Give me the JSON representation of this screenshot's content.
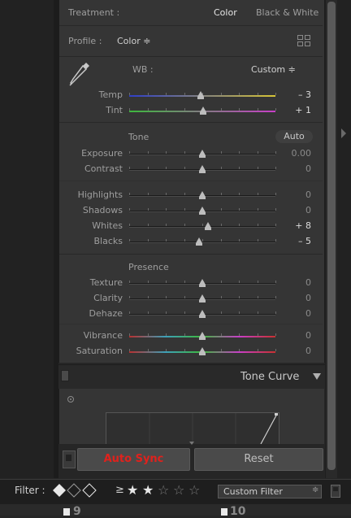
{
  "basic": {
    "treatment_label": "Treatment :",
    "treatment_color": "Color",
    "treatment_bw": "Black & White",
    "profile_label": "Profile :",
    "profile_value": "Color ≑",
    "wb_label": "WB :",
    "wb_value": "Custom ≑"
  },
  "wb_sliders": [
    {
      "label": "Temp",
      "value": "– 3",
      "level": 0.49
    },
    {
      "label": "Tint",
      "value": "+ 1",
      "level": 0.505
    }
  ],
  "tone": {
    "title": "Tone",
    "auto_label": "Auto",
    "sliders": [
      {
        "label": "Exposure",
        "value": "0.00",
        "level": 0.5
      },
      {
        "label": "Contrast",
        "value": "0",
        "level": 0.5
      }
    ],
    "sliders2": [
      {
        "label": "Highlights",
        "value": "0",
        "level": 0.5
      },
      {
        "label": "Shadows",
        "value": "0",
        "level": 0.5
      },
      {
        "label": "Whites",
        "value": "+ 8",
        "level": 0.54
      },
      {
        "label": "Blacks",
        "value": "– 5",
        "level": 0.475
      }
    ]
  },
  "presence": {
    "title": "Presence",
    "sliders": [
      {
        "label": "Texture",
        "value": "0",
        "level": 0.5
      },
      {
        "label": "Clarity",
        "value": "0",
        "level": 0.5
      },
      {
        "label": "Dehaze",
        "value": "0",
        "level": 0.5
      }
    ],
    "sliders2": [
      {
        "label": "Vibrance",
        "value": "0",
        "level": 0.5
      },
      {
        "label": "Saturation",
        "value": "0",
        "level": 0.5
      }
    ]
  },
  "tone_curve": {
    "title": "Tone Curve"
  },
  "buttons": {
    "auto_sync": "Auto Sync",
    "reset": "Reset"
  },
  "filter": {
    "label": "Filter :",
    "rating_op": "≥",
    "stars_total": 5,
    "stars_filled": 2,
    "custom_filter": "Custom Filter",
    "filmstrip_numbers": [
      "9",
      "10"
    ]
  },
  "colors": {
    "panel_bg": "#353535",
    "auto_sync_text": "#e0211c",
    "value_bright": "#dcdcdc"
  }
}
